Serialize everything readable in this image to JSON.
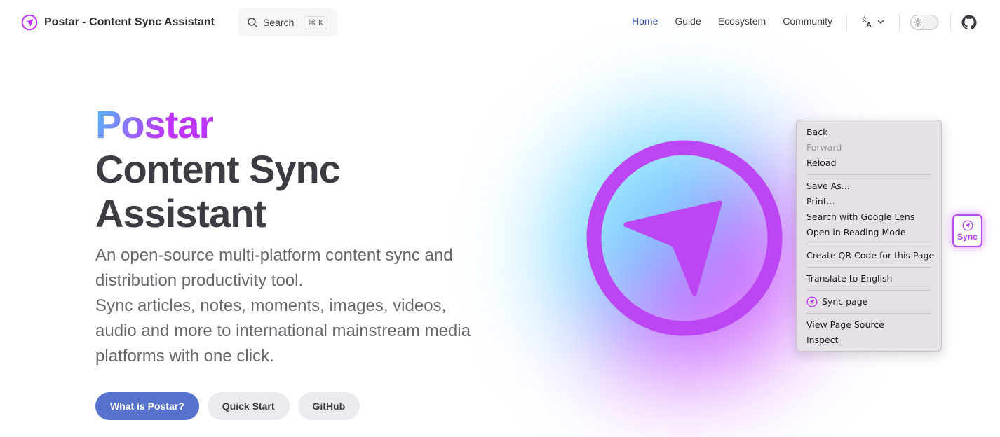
{
  "header": {
    "title": "Postar - Content Sync Assistant",
    "search": {
      "label": "Search",
      "shortcut": "⌘ K"
    },
    "nav": [
      {
        "label": "Home",
        "active": true
      },
      {
        "label": "Guide"
      },
      {
        "label": "Ecosystem"
      },
      {
        "label": "Community"
      }
    ],
    "icons": {
      "logo": "paper-plane-logo",
      "language": "translate-icon",
      "theme": "sun-icon",
      "repo": "github-icon"
    }
  },
  "hero": {
    "name": "Postar",
    "text_line1": "Content Sync",
    "text_line2": "Assistant",
    "tagline_lines": [
      "An open-source multi-platform content sync and",
      "distribution productivity tool.",
      "Sync articles, notes, moments, images, videos,",
      "audio and more to international mainstream media",
      "platforms with one click."
    ],
    "actions": [
      {
        "label": "What is Postar?",
        "theme": "brand"
      },
      {
        "label": "Quick Start",
        "theme": "alt"
      },
      {
        "label": "GitHub",
        "theme": "alt"
      }
    ]
  },
  "context_menu": {
    "groups": [
      [
        {
          "label": "Back"
        },
        {
          "label": "Forward",
          "disabled": true
        },
        {
          "label": "Reload"
        }
      ],
      [
        {
          "label": "Save As..."
        },
        {
          "label": "Print..."
        },
        {
          "label": "Search with Google Lens"
        },
        {
          "label": "Open in Reading Mode"
        }
      ],
      [
        {
          "label": "Create QR Code for this Page"
        }
      ],
      [
        {
          "label": "Translate to English"
        }
      ],
      [
        {
          "label": "Sync page",
          "icon": "paper-plane-icon"
        }
      ],
      [
        {
          "label": "View Page Source"
        },
        {
          "label": "Inspect"
        }
      ]
    ]
  },
  "sync_button": {
    "label": "Sync",
    "icon": "paper-plane-icon"
  },
  "colors": {
    "brand": "#5672cd",
    "nav_active": "#3451b2",
    "purple": "#bd34fe",
    "cyan": "#47caff",
    "text": "#3c3c43",
    "muted": "#67676c"
  }
}
